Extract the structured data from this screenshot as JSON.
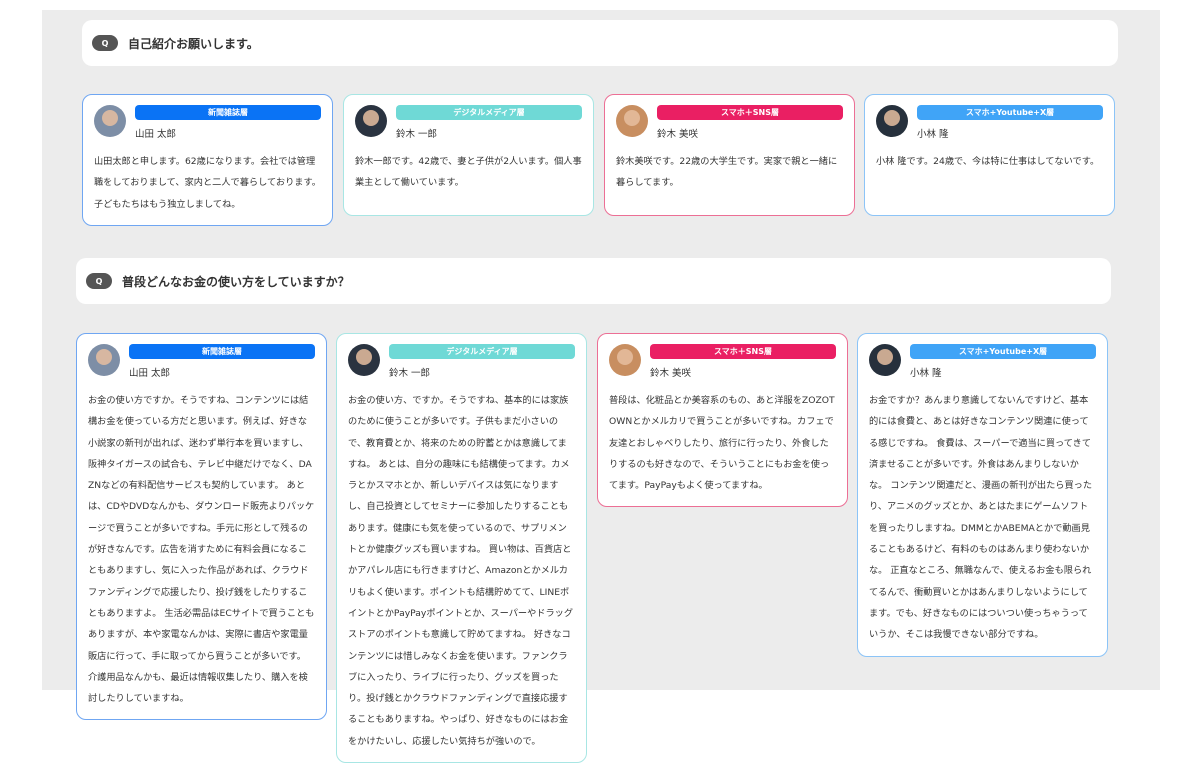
{
  "q_mark": "Q",
  "colors": {
    "newspaper": "#0a73f5",
    "digital": "#6fd9d6",
    "sns": "#ea1f63",
    "youtube": "#40a4f7"
  },
  "sections": [
    {
      "question": "自己紹介お願いします。",
      "cards": [
        {
          "badge": "新聞雑誌層",
          "name": "山田 太郎",
          "text": "山田太郎と申します。62歳になります。会社では管理職をしておりまして、家内と二人で暮らしております。子どもたちはもう独立しましてね。"
        },
        {
          "badge": "デジタルメディア層",
          "name": "鈴木 一郎",
          "text": "鈴木一郎です。42歳で、妻と子供が2人います。個人事業主として働いています。"
        },
        {
          "badge": "スマホ＋SNS層",
          "name": "鈴木 美咲",
          "text": "鈴木美咲です。22歳の大学生です。実家で親と一緒に暮らしてます。"
        },
        {
          "badge": "スマホ+Youtube+X層",
          "name": "小林 隆",
          "text": "小林 隆です。24歳で、今は特に仕事はしてないです。"
        }
      ]
    },
    {
      "question": "普段どんなお金の使い方をしていますか？",
      "cards": [
        {
          "badge": "新聞雑誌層",
          "name": "山田 太郎",
          "text": "お金の使い方ですか。そうですね、コンテンツには結構お金を使っている方だと思います。例えば、好きな小説家の新刊が出れば、迷わず単行本を買いますし、阪神タイガースの試合も、テレビ中継だけでなく、DAZNなどの有料配信サービスも契約しています。 あとは、CDやDVDなんかも、ダウンロード販売よりパッケージで買うことが多いですね。手元に形として残るのが好きなんです。広告を消すために有料会員になることもありますし、気に入った作品があれば、クラウドファンディングで応援したり、投げ銭をしたりすることもありますよ。 生活必需品はECサイトで買うこともありますが、本や家電なんかは、実際に書店や家電量販店に行って、手に取ってから買うことが多いです。介護用品なんかも、最近は情報収集したり、購入を検討したりしていますね。"
        },
        {
          "badge": "デジタルメディア層",
          "name": "鈴木 一郎",
          "text": "お金の使い方、ですか。そうですね、基本的には家族のために使うことが多いです。子供もまだ小さいので、教育費とか、将来のための貯蓄とかは意識してますね。 あとは、自分の趣味にも結構使ってます。カメラとかスマホとか、新しいデバイスは気になりますし、自己投資としてセミナーに参加したりすることもあります。健康にも気を使っているので、サプリメントとか健康グッズも買いますね。 買い物は、百貨店とかアパレル店にも行きますけど、Amazonとかメルカリもよく使います。ポイントも結構貯めてて、LINEポイントとかPayPayポイントとか、スーパーやドラッグストアのポイントも意識して貯めてますね。 好きなコンテンツには惜しみなくお金を使います。ファンクラブに入ったり、ライブに行ったり、グッズを買ったり。投げ銭とかクラウドファンディングで直接応援することもありますね。やっぱり、好きなものにはお金をかけたいし、応援したい気持ちが強いので。"
        },
        {
          "badge": "スマホ＋SNS層",
          "name": "鈴木 美咲",
          "text": "普段は、化粧品とか美容系のもの、あと洋服をZOZOTOWNとかメルカリで買うことが多いですね。カフェで友達とおしゃべりしたり、旅行に行ったり、外食したりするのも好きなので、そういうことにもお金を使ってます。PayPayもよく使ってますね。"
        },
        {
          "badge": "スマホ+Youtube+X層",
          "name": "小林 隆",
          "text": "お金ですか？あんまり意識してないんですけど、基本的には食費と、あとは好きなコンテンツ関連に使ってる感じですね。 食費は、スーパーで適当に買ってきて済ませることが多いです。外食はあんまりしないかな。 コンテンツ関連だと、漫画の新刊が出たら買ったり、アニメのグッズとか、あとはたまにゲームソフトを買ったりしますね。DMMとかABEMAとかで動画見ることもあるけど、有料のものはあんまり使わないかな。 正直なところ、無職なんで、使えるお金も限られてるんで、衝動買いとかはあんまりしないようにしてます。でも、好きなものにはついつい使っちゃうっていうか、そこは我慢できない部分ですね。"
        }
      ]
    }
  ]
}
